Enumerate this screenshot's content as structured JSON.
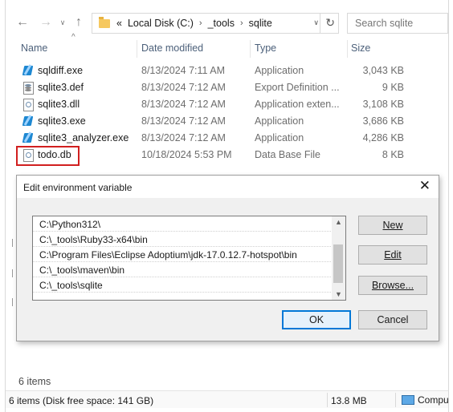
{
  "nav": {
    "back_icon": "arrow-left-icon",
    "forward_icon": "arrow-right-icon",
    "recent_icon": "chevron-down-icon",
    "up_icon": "arrow-up-icon"
  },
  "address": {
    "overflow": "«",
    "crumbs": [
      "Local Disk (C:)",
      "_tools",
      "sqlite"
    ],
    "separator": "›"
  },
  "search": {
    "placeholder": "Search sqlite"
  },
  "columns": {
    "name": "Name",
    "date": "Date modified",
    "type": "Type",
    "size": "Size"
  },
  "files": [
    {
      "name": "sqldiff.exe",
      "date": "8/13/2024 7:11 AM",
      "type": "Application",
      "size": "3,043 KB",
      "icon": "exe"
    },
    {
      "name": "sqlite3.def",
      "date": "8/13/2024 7:12 AM",
      "type": "Export Definition ...",
      "size": "9 KB",
      "icon": "def"
    },
    {
      "name": "sqlite3.dll",
      "date": "8/13/2024 7:12 AM",
      "type": "Application exten...",
      "size": "3,108 KB",
      "icon": "dll"
    },
    {
      "name": "sqlite3.exe",
      "date": "8/13/2024 7:12 AM",
      "type": "Application",
      "size": "3,686 KB",
      "icon": "exe"
    },
    {
      "name": "sqlite3_analyzer.exe",
      "date": "8/13/2024 7:12 AM",
      "type": "Application",
      "size": "4,286 KB",
      "icon": "exe"
    },
    {
      "name": "todo.db",
      "date": "10/18/2024 5:53 PM",
      "type": "Data Base File",
      "size": "8 KB",
      "icon": "db",
      "highlighted": true
    }
  ],
  "items_count": "6 items",
  "status": {
    "left": "6 items (Disk free space: 141 GB)",
    "size": "13.8 MB",
    "computer": "Compu"
  },
  "dialog": {
    "title": "Edit environment variable",
    "close": "✕",
    "entries": [
      "C:\\Python312\\",
      "C:\\_tools\\Ruby33-x64\\bin",
      "C:\\Program Files\\Eclipse Adoptium\\jdk-17.0.12.7-hotspot\\bin",
      "C:\\_tools\\maven\\bin",
      "C:\\_tools\\sqlite"
    ],
    "buttons": {
      "new": "New",
      "edit": "Edit",
      "browse": "Browse...",
      "ok": "OK",
      "cancel": "Cancel"
    }
  },
  "colors": {
    "highlight_box": "#d11f1f",
    "default_button_border": "#0078d7"
  }
}
